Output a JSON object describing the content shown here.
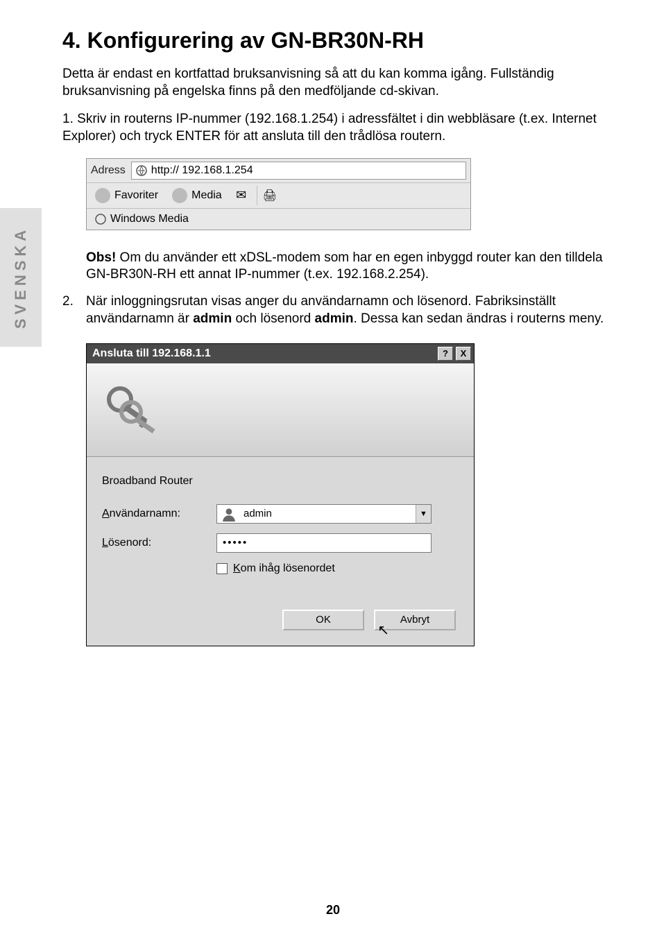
{
  "side_tab": "SVENSKA",
  "heading": "4. Konfigurering av GN-BR30N-RH",
  "intro": "Detta är endast en kortfattad bruksanvisning så att du kan komma igång. Fullständig bruksanvisning på engelska finns på den medföljande cd-skivan.",
  "step1": {
    "num": "1.",
    "text": "Skriv in routerns IP-nummer (192.168.1.254) i adressfältet i din webbläsare (t.ex. Internet Explorer) och tryck ENTER för att ansluta till den trådlösa routern."
  },
  "toolbar": {
    "address_label": "Adress",
    "address_value": "http:// 192.168.1.254",
    "favorites": "Favoriter",
    "media": "Media",
    "windows_media": "Windows Media"
  },
  "obs": {
    "label": "Obs!",
    "text": " Om du använder ett xDSL-modem som har en egen inbyggd router kan den tilldela GN-BR30N-RH ett annat IP-nummer (t.ex. 192.168.2.254)."
  },
  "step2": {
    "num": "2.",
    "text_before": "När inloggningsrutan visas anger du användarnamn och lösenord. Fabriksinställt användarnamn är ",
    "bold1": "admin",
    "mid": " och lösenord ",
    "bold2": "admin",
    "text_after": ". Dessa kan sedan ändras i routerns meny."
  },
  "dialog": {
    "title": "Ansluta till 192.168.1.1",
    "help": "?",
    "close": "X",
    "subtitle": "Broadband Router",
    "user_label": "Användarnamn:",
    "user_value": "admin",
    "pw_label": "Lösenord:",
    "pw_value": "•••••",
    "remember": "Kom ihåg lösenordet",
    "ok": "OK",
    "cancel": "Avbryt"
  },
  "page_number": "20"
}
